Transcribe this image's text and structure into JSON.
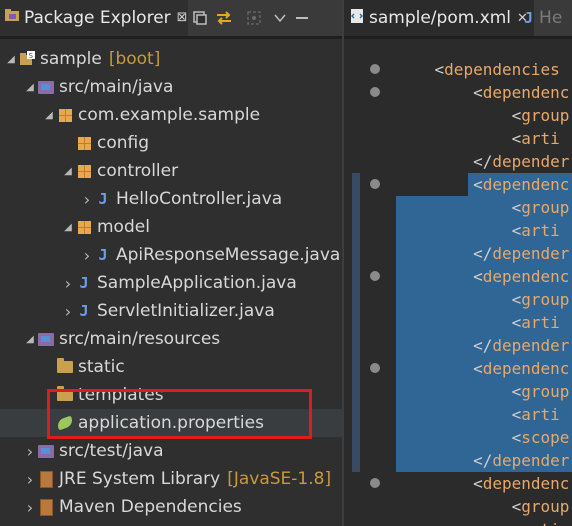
{
  "explorer": {
    "title": "Package Explorer",
    "close_glyph": "⊠",
    "toolbar_icons": [
      "collapse-all-icon",
      "link-with-editor-icon",
      "focus-icon",
      "view-menu-icon",
      "minimize-icon"
    ],
    "tree": [
      {
        "label": "sample",
        "decoration": "[boot]",
        "depth": 0,
        "twisty": "expanded",
        "icon": "project-icon"
      },
      {
        "label": "src/main/java",
        "depth": 1,
        "twisty": "expanded",
        "icon": "source-folder-icon"
      },
      {
        "label": "com.example.sample",
        "depth": 2,
        "twisty": "expanded",
        "icon": "package-icon"
      },
      {
        "label": "config",
        "depth": 3,
        "twisty": "none",
        "icon": "package-icon"
      },
      {
        "label": "controller",
        "depth": 3,
        "twisty": "expanded",
        "icon": "package-icon"
      },
      {
        "label": "HelloController.java",
        "depth": 4,
        "twisty": "collapsed",
        "icon": "java-file-icon"
      },
      {
        "label": "model",
        "depth": 3,
        "twisty": "expanded",
        "icon": "package-icon"
      },
      {
        "label": "ApiResponseMessage.java",
        "depth": 4,
        "twisty": "collapsed",
        "icon": "java-file-icon"
      },
      {
        "label": "SampleApplication.java",
        "depth": 3,
        "twisty": "collapsed",
        "icon": "java-file-icon"
      },
      {
        "label": "ServletInitializer.java",
        "depth": 3,
        "twisty": "collapsed",
        "icon": "java-file-icon"
      },
      {
        "label": "src/main/resources",
        "depth": 1,
        "twisty": "expanded",
        "icon": "source-folder-icon"
      },
      {
        "label": "static",
        "depth": 2,
        "twisty": "none",
        "icon": "folder-icon"
      },
      {
        "label": "templates",
        "depth": 2,
        "twisty": "none",
        "icon": "folder-icon"
      },
      {
        "label": "application.properties",
        "depth": 2,
        "twisty": "none",
        "icon": "properties-file-icon",
        "selected": true
      },
      {
        "label": "src/test/java",
        "depth": 1,
        "twisty": "collapsed",
        "icon": "source-folder-icon"
      },
      {
        "label": "JRE System Library",
        "decoration": "[JavaSE-1.8]",
        "depth": 1,
        "twisty": "collapsed",
        "icon": "library-icon"
      },
      {
        "label": "Maven Dependencies",
        "depth": 1,
        "twisty": "collapsed",
        "icon": "library-icon"
      }
    ]
  },
  "editor": {
    "tabs": [
      {
        "label": "sample/pom.xml",
        "active": true
      },
      {
        "label": "He",
        "active": false
      }
    ],
    "lines": [
      {
        "text": "    <dependencies",
        "fold": true
      },
      {
        "text": "        <dependenc",
        "fold": true
      },
      {
        "text": "            <group",
        "fold": false
      },
      {
        "text": "            <arti",
        "fold": false
      },
      {
        "text": "        </depender",
        "fold": false
      },
      {
        "text": "        <dependenc",
        "fold": true,
        "selected": true
      },
      {
        "text": "            <group",
        "fold": false,
        "selected": true
      },
      {
        "text": "            <arti",
        "fold": false,
        "selected": true
      },
      {
        "text": "        </depender",
        "fold": false,
        "selected": true
      },
      {
        "text": "        <dependenc",
        "fold": true,
        "selected": true
      },
      {
        "text": "            <group",
        "fold": false,
        "selected": true
      },
      {
        "text": "            <arti",
        "fold": false,
        "selected": true
      },
      {
        "text": "        </depender",
        "fold": false,
        "selected": true
      },
      {
        "text": "        <dependenc",
        "fold": true,
        "selected": true
      },
      {
        "text": "            <group",
        "fold": false,
        "selected": true
      },
      {
        "text": "            <arti",
        "fold": false,
        "selected": true
      },
      {
        "text": "            <scope",
        "fold": false,
        "selected": true
      },
      {
        "text": "        </depender",
        "fold": false,
        "selected": true
      },
      {
        "text": "        <dependenc",
        "fold": true
      },
      {
        "text": "            <group",
        "fold": false
      },
      {
        "text": "            <arti",
        "fold": false
      }
    ]
  },
  "colors": {
    "accent_highlight": "#e01b1b",
    "selection": "#2f6695",
    "tag": "#e8a86a",
    "decoration": "#c89a3a"
  }
}
